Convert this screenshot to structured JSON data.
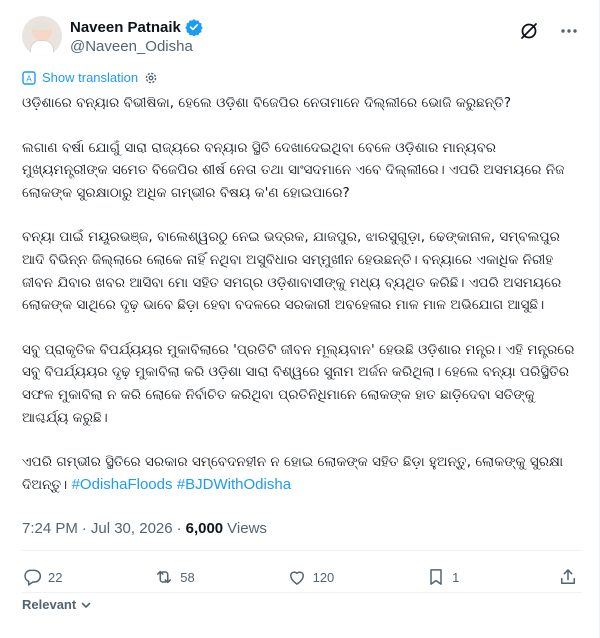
{
  "author": {
    "display_name": "Naveen Patnaik",
    "handle": "@Naveen_Odisha",
    "verified": true,
    "verified_color": "#1d9bf0"
  },
  "header_icons": {
    "grok": "grok-icon",
    "more": "more-icon"
  },
  "translate": {
    "label": "Show translation",
    "icon": "translate-icon",
    "settings_icon": "gear-icon"
  },
  "body": {
    "paragraphs": [
      "ଓଡ଼ିଶାରେ ବନ୍ୟାର ବିଭୀଷିକା, ହେଲେ ଓଡ଼ିଶା ବିଜେପିର ନେତାମାନେ ଦିଲ୍ଲୀରେ ଭୋଜି କରୁଛନ୍ତି?",
      "ଲଗାଣ ବର୍ଷା ଯୋଗୁଁ ସାରା ରାଜ୍ୟରେ ବନ୍ୟାର ସ୍ଥିତି ଦେଖାଦେଇଥିବା ବେଳେ ଓଡ଼ିଶାର ମାନ୍ୟବର ମୁଖ୍ୟମନ୍ତ୍ରୀଙ୍କ ସମେତ ବିଜେପିର ଶୀର୍ଷ ନେତା ତଥା ସାଂସଦମାନେ ଏବେ ଦିଲ୍ଲୀରେ। ଏପରି ଅସମୟରେ ନିଜ ଲୋକଙ୍କ ସୁରକ୍ଷାଠାରୁ ଅଧିକ ଗମ୍ଭୀର ବିଷୟ କ'ଣ ହୋଇପାରେ?",
      "ବନ୍ୟା ପାଇଁ ମୟୂରଭଞ୍ଜ, ବାଲେଶ୍ୱରଠୁ ନେଇ ଭଦ୍ରକ, ଯାଜପୁର, ଝାରସୁଗୁଡ଼ା, ଢେଙ୍କାନାଳ, ସମ୍ବଲପୁର ଆଦି ବିଭିନ୍ନ ଜିଲ୍ଲାରେ ଲୋକେ ନାହିଁ ନଥିବା ଅସୁବିଧାର ସମ୍ମୁଖୀନ ହେଉଛନ୍ତି। ବନ୍ୟାରେ ଏକାଧିକ ନିରୀହ ଜୀବନ ଯିବାର ଖବର ଆସିବା ମୋ ସହିତ ସମଗ୍ର ଓଡ଼ିଶାବାସୀଙ୍କୁ ମଧ୍ୟ ବ୍ୟଥିତ କରିଛି। ଏପରି ଅସମୟରେ ଲୋକଙ୍କ ସାଥିରେ ଦୃଢ଼ ଭାବେ ଛିଡ଼ା ହେବା ବଦଳରେ ସରକାରୀ ଅବହେଳାର ମାଳ ମାଳ ଅଭିଯୋଗ ଆସୁଛି।",
      "ସବୁ ପ୍ରାକୃତିକ ବିପର୍ଯ୍ୟୟର ମୁକାବିଲାରେ 'ପ୍ରତିଟି ଜୀବନ ମୂଲ୍ୟବାନ' ହେଉଛି ଓଡ଼ିଶାର ମନ୍ତ୍ର। ଏହି ମନ୍ତ୍ରରେ ସବୁ ବିପର୍ଯ୍ୟୟର ଦୃଢ଼ ମୁକାବିଲା କରି ଓଡ଼ିଶା ସାରା ବିଶ୍ୱରେ ସୁନାମ ଅର୍ଜନ କରିଥିଲା। ହେଲେ ବନ୍ୟା ପରିସ୍ଥିତିର ସଫଳ ମୁକାବିଲା ନ କରି ଲୋକେ ନିର୍ବାଚିତ କରିଥିବା ପ୍ରତିନିଧିମାନେ ଲୋକଙ୍କ ହାତ ଛାଡ଼ିଦେବା ସତିଙ୍କୁ ଆଶ୍ଚର୍ଯ୍ୟ କରୁଛି।",
      "ଏପରି ଗମ୍ଭୀର ସ୍ଥିତିରେ ସରକାର ସମ୍ବେଦନହୀନ ନ ହୋଇ ଲୋକଙ୍କ ସହିତ ଛିଡ଼ା ହୁଅନ୍ତୁ, ଲୋକଙ୍କୁ ସୁରକ୍ଷା ଦିଅନ୍ତୁ।"
    ],
    "hashtags": [
      "#OdishaFloods",
      "#BJDWithOdisha"
    ],
    "hashtag_color": "#1d9bf0"
  },
  "meta": {
    "time": "7:24 PM",
    "separator": "·",
    "date": "Jul 30, 2026",
    "views_count": "6,000",
    "views_label": "Views"
  },
  "actions": {
    "replies": "22",
    "reposts": "58",
    "likes": "120",
    "bookmarks": "1",
    "icons": [
      "reply-icon",
      "repost-icon",
      "like-icon",
      "bookmark-icon",
      "share-icon"
    ]
  },
  "sort": {
    "label": "Relevant",
    "icon": "chevron-down-icon"
  }
}
